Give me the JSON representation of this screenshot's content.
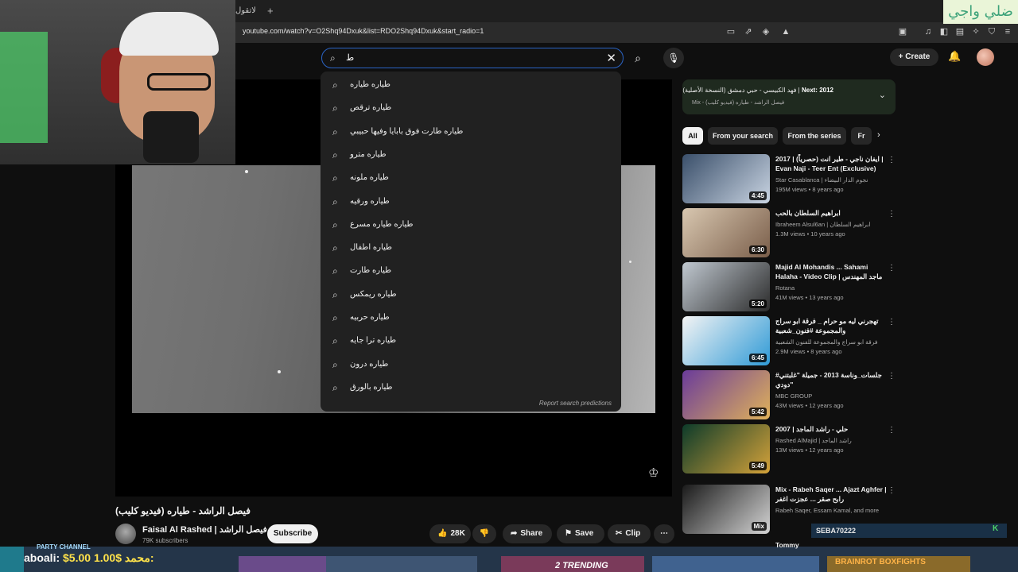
{
  "browser": {
    "tab_title": "لاتقول",
    "new_tab": "+",
    "url": "youtube.com/watch?v=O2Shq94Dxuk&list=RDO2Shq94Dxuk&start_radio=1",
    "banner_text": "ضلي واجي"
  },
  "header": {
    "search_query": "ط",
    "create_label": "Create"
  },
  "suggestions": [
    "طياره طياره",
    "طياره ترقص",
    "طياره طارت فوق بابايا وفيها حبيبي",
    "طياره مترو",
    "طياره ملونه",
    "طياره ورقيه",
    "طياره طياره مسرع",
    "طياره اطفال",
    "طياره طارت",
    "طياره ريمكس",
    "طياره حربيه",
    "طياره ترا جايه",
    "طياره درون",
    "طياره بالورق"
  ],
  "report_label": "Report search predictions",
  "video": {
    "title": "فيصل الراشد - طياره (فيديو كليب)",
    "channel_name": "Faisal Al Rashed | فيصل الراشد",
    "subscribers": "79K subscribers",
    "subscribe_label": "Subscribe",
    "likes": "28K",
    "share_label": "Share",
    "save_label": "Save",
    "clip_label": "Clip"
  },
  "next_card": {
    "prefix": "Next: 2012",
    "title": "فهد الكبيسي - حبي دمشق (النسخة الأصلية) |",
    "mix": "Mix - فيصل الراشد - طياره (فيديو كليب)"
  },
  "chips": [
    "All",
    "From your search",
    "From the series",
    "Fr"
  ],
  "related": [
    {
      "title": "ايفان ناجي - طير انت (حصرياً) | 2017 | Evan Naji - Teer Ent (Exclusive)",
      "channel": "Star Casablanca | نجوم الدار البيضاء",
      "meta": "195M views • 8 years ago",
      "duration": "4:45"
    },
    {
      "title": "ابراهيم السلطان بالحب",
      "channel": "Ibraheem Alsul6an | ابراهيم السلطان",
      "meta": "1.3M views • 10 years ago",
      "duration": "6:30"
    },
    {
      "title": "Majid Al Mohandis ... Sahami Halaha - Video Clip | ماجد المهندس ...",
      "channel": "Rotana",
      "meta": "41M views • 13 years ago",
      "duration": "5:20"
    },
    {
      "title": "تهجرني ليه مو حرام _ فرقة ابو سراج والمجموعة #فنون_شعبية",
      "channel": "فرقة ابو سراج والمجموعة للفنون الشعبية",
      "meta": "2.9M views • 8 years ago",
      "duration": "6:45"
    },
    {
      "title": "#جلسات_وناسة 2013 - جميلة \"غلبتني دودي\"",
      "channel": "MBC GROUP",
      "meta": "43M views • 12 years ago",
      "duration": "5:42"
    },
    {
      "title": "2007 | حلي - راشد الماجد",
      "channel": "Rashed AlMajid | راشد الماجد",
      "meta": "13M views • 12 years ago",
      "duration": "5:49"
    },
    {
      "title": "Mix - Rabeh Saqer ... Ajazt Aghfer | رابح صقر ... عجزت اغفر",
      "channel": "Rabeh Saqer, Essam Kamal, and more",
      "meta": "",
      "duration": "Mix"
    }
  ],
  "overlay": {
    "seba": "SEBA70222",
    "tommy": "Tommy",
    "party": "PARTY CHANNEL",
    "donation_name": "aboali:",
    "donation_amount": "$5.00",
    "donation_extra": "1.00$ محمد:",
    "trending": "TRENDING",
    "trending_num": "2",
    "boxfights": "BRAINROT BOXFIGHTS"
  }
}
